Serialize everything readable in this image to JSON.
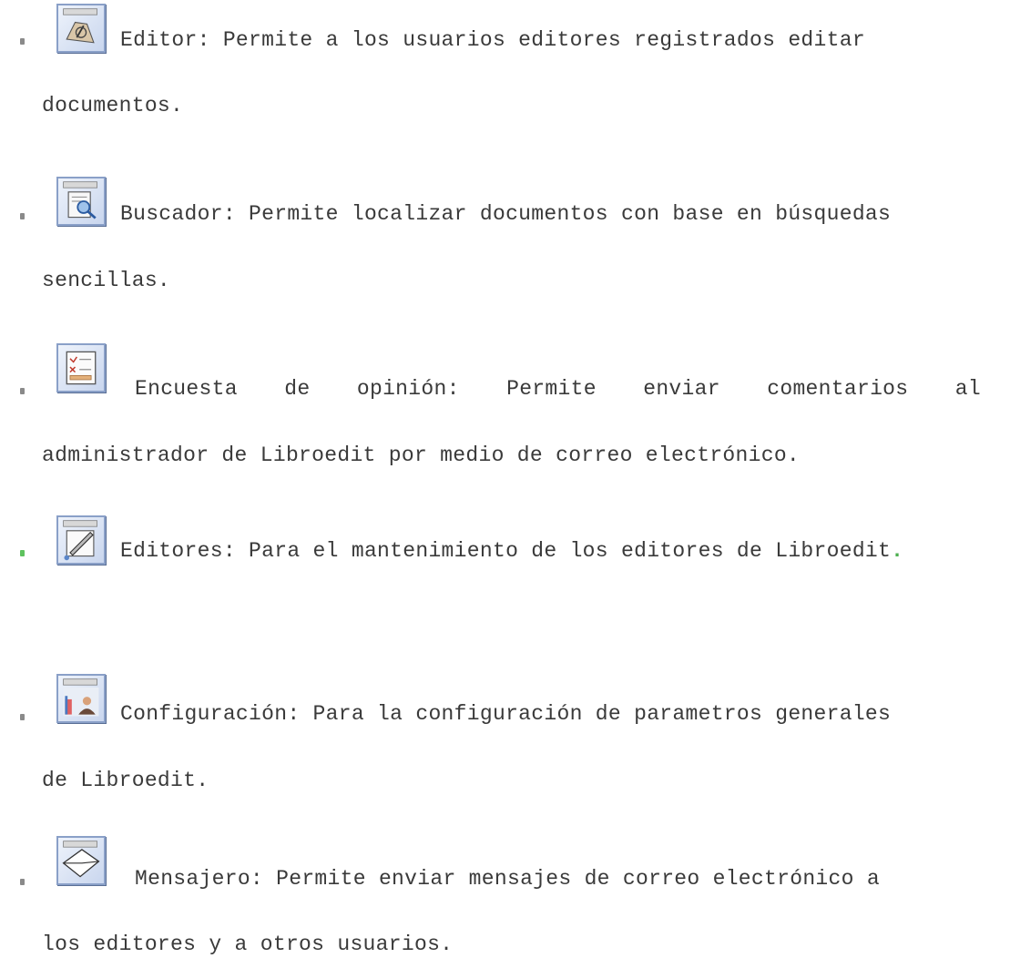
{
  "items": [
    {
      "icon": "editor-icon",
      "line1": "Editor: Permite a los usuarios editores registrados editar",
      "line2": "documentos."
    },
    {
      "icon": "buscador-icon",
      "line1": "Buscador: Permite localizar documentos con base en búsquedas",
      "line2": "sencillas."
    },
    {
      "icon": "encuesta-icon",
      "line1_words": [
        "Encuesta",
        "de",
        "opinión:",
        "Permite",
        "enviar",
        "comentarios",
        "al"
      ],
      "line2": "administrador de Libroedit por medio de correo electrónico."
    },
    {
      "icon": "editores-icon",
      "line1": "Editores: Para el mantenimiento de los editores de Libroedit",
      "trailing": "."
    },
    {
      "icon": "configuracion-icon",
      "line1": "Configuración: Para la configuración de parametros generales",
      "line2": "de Libroedit."
    },
    {
      "icon": "mensajero-icon",
      "line1": "Mensajero: Permite enviar mensajes de correo electrónico a",
      "line2": "los editores y a otros usuarios."
    }
  ],
  "colors": {
    "text": "#3a3a3a",
    "bullet": "#8a8a8a",
    "bullet_highlight": "#5ec25e",
    "icon_border": "#8aa0c8"
  }
}
